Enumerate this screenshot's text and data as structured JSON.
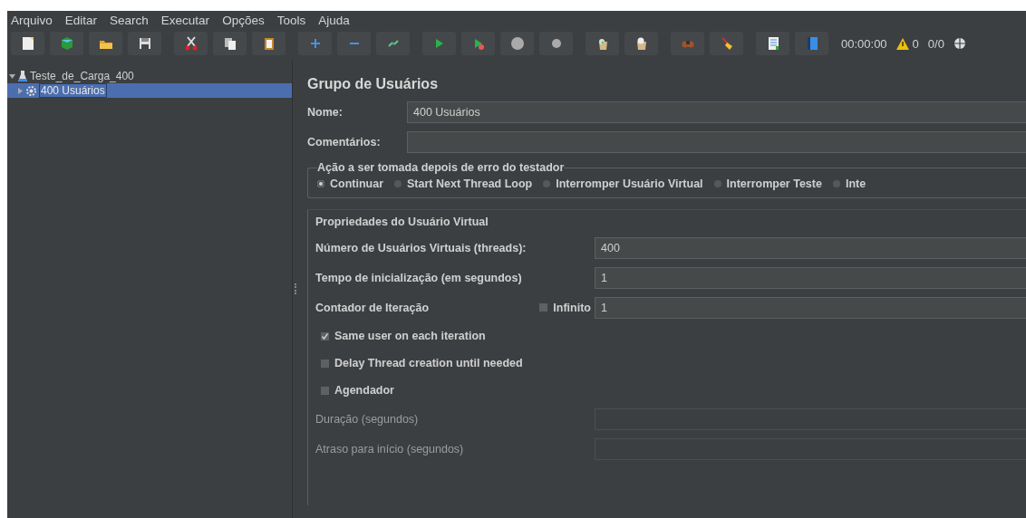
{
  "menu": [
    {
      "label": "Arquivo"
    },
    {
      "label": "Editar"
    },
    {
      "label": "Search"
    },
    {
      "label": "Executar"
    },
    {
      "label": "Opções"
    },
    {
      "label": "Tools"
    },
    {
      "label": "Ajuda"
    }
  ],
  "status": {
    "timer": "00:00:00",
    "warnings": "0",
    "threads": "0/0"
  },
  "tree": [
    {
      "label": "Teste_de_Carga_400",
      "kind": "test-plan",
      "expanded": true,
      "selected": false,
      "children": [
        {
          "label": "400 Usuários",
          "kind": "thread-group",
          "expanded": false,
          "selected": true
        }
      ]
    }
  ],
  "panel": {
    "title": "Grupo de Usuários",
    "name_field": {
      "label": "Nome:",
      "value": "400 Usuários"
    },
    "comments_field": {
      "label": "Comentários:"
    },
    "error_action": {
      "legend": "Ação a ser tomada depois de erro do testador",
      "options": [
        {
          "label": "Continuar",
          "selected": true
        },
        {
          "label": "Start Next Thread Loop",
          "selected": false
        },
        {
          "label": "Interromper Usuário Virtual",
          "selected": false
        },
        {
          "label": "Interromper Teste",
          "selected": false
        },
        {
          "label": "Inte",
          "selected": false
        }
      ]
    },
    "properties": {
      "title": "Propriedades do Usuário Virtual",
      "threads": {
        "label": "Número de Usuários Virtuais (threads):",
        "value": "400"
      },
      "ramp_up": {
        "label": "Tempo de inicialização (em segundos)",
        "value": "1"
      },
      "loop": {
        "label": "Contador de Iteração",
        "infinite_label": "Infinito",
        "infinite": false,
        "value": "1"
      },
      "options": [
        {
          "label": "Same user on each iteration",
          "checked": true
        },
        {
          "label": "Delay Thread creation until needed",
          "checked": false
        },
        {
          "label": "Agendador",
          "checked": false
        }
      ],
      "scheduler_fields": [
        {
          "label": "Duração (segundos)",
          "disabled": true
        },
        {
          "label": "Atraso para início (segundos)",
          "disabled": true
        }
      ]
    }
  }
}
